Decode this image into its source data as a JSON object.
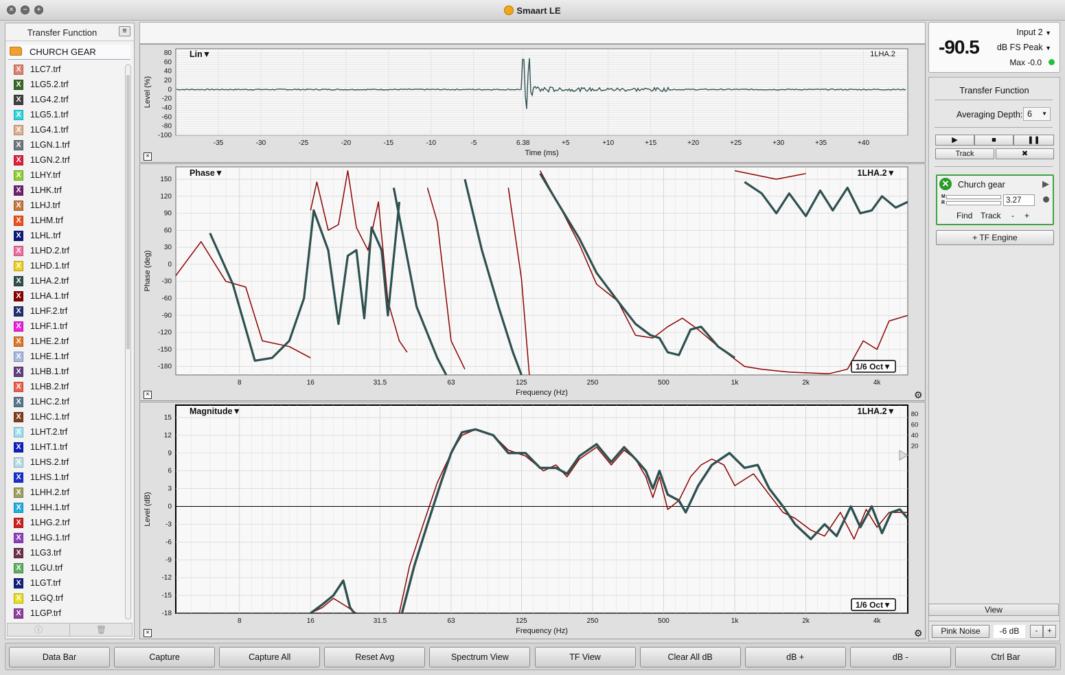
{
  "window": {
    "title": "Smaart LE"
  },
  "left_panel": {
    "title": "Transfer Function",
    "folder": "CHURCH GEAR",
    "files": [
      {
        "name": "1LC7.trf",
        "color": "#e08070"
      },
      {
        "name": "1LG5.2.trf",
        "color": "#3a6a2a"
      },
      {
        "name": "1LG4.2.trf",
        "color": "#404040"
      },
      {
        "name": "1LG5.1.trf",
        "color": "#30d8e0"
      },
      {
        "name": "1LG4.1.trf",
        "color": "#e0b090"
      },
      {
        "name": "1LGN.1.trf",
        "color": "#707880"
      },
      {
        "name": "1LGN.2.trf",
        "color": "#e02040"
      },
      {
        "name": "1LHY.trf",
        "color": "#90d030"
      },
      {
        "name": "1LHK.trf",
        "color": "#702070"
      },
      {
        "name": "1LHJ.trf",
        "color": "#c87840"
      },
      {
        "name": "1LHM.trf",
        "color": "#f05020"
      },
      {
        "name": "1LHL.trf",
        "color": "#101880"
      },
      {
        "name": "1LHD.2.trf",
        "color": "#f070a0"
      },
      {
        "name": "1LHD.1.trf",
        "color": "#f0d020"
      },
      {
        "name": "1LHA.2.trf",
        "color": "#2f5050"
      },
      {
        "name": "1LHA.1.trf",
        "color": "#8b0000"
      },
      {
        "name": "1LHF.2.trf",
        "color": "#203070"
      },
      {
        "name": "1LHF.1.trf",
        "color": "#f020e0"
      },
      {
        "name": "1LHE.2.trf",
        "color": "#e07828"
      },
      {
        "name": "1LHE.1.trf",
        "color": "#a8b8e0"
      },
      {
        "name": "1LHB.1.trf",
        "color": "#604080"
      },
      {
        "name": "1LHB.2.trf",
        "color": "#f06050"
      },
      {
        "name": "1LHC.2.trf",
        "color": "#5a7890"
      },
      {
        "name": "1LHC.1.trf",
        "color": "#804020"
      },
      {
        "name": "1LHT.2.trf",
        "color": "#a0e0f0"
      },
      {
        "name": "1LHT.1.trf",
        "color": "#1020c0"
      },
      {
        "name": "1LHS.2.trf",
        "color": "#b8e0e8"
      },
      {
        "name": "1LHS.1.trf",
        "color": "#1830d0"
      },
      {
        "name": "1LHH.2.trf",
        "color": "#a0a060"
      },
      {
        "name": "1LHH.1.trf",
        "color": "#20b0e0"
      },
      {
        "name": "1LHG.2.trf",
        "color": "#d02020"
      },
      {
        "name": "1LHG.1.trf",
        "color": "#9040c0"
      },
      {
        "name": "1LG3.trf",
        "color": "#703050"
      },
      {
        "name": "1LGU.trf",
        "color": "#60b060"
      },
      {
        "name": "1LGT.trf",
        "color": "#102080"
      },
      {
        "name": "1LGQ.trf",
        "color": "#e8e020"
      },
      {
        "name": "1LGP.trf",
        "color": "#9040a0"
      }
    ]
  },
  "lin_graph": {
    "title": "Lin▼",
    "trace": "1LHA.2",
    "ylabel": "Level (%)",
    "xlabel": "Time (ms)",
    "yticks": [
      "80",
      "60",
      "40",
      "20",
      "0",
      "-20",
      "-40",
      "-60",
      "-80",
      "-100"
    ],
    "xticks": [
      "-35",
      "-30",
      "-25",
      "-20",
      "-15",
      "-10",
      "-5",
      "6.38",
      "+5",
      "+10",
      "+15",
      "+20",
      "+25",
      "+30",
      "+35",
      "+40"
    ]
  },
  "phase_graph": {
    "title": "Phase▼",
    "trace": "1LHA.2▼",
    "ylabel": "Phase (deg)",
    "xlabel": "Frequency (Hz)",
    "smoothing": "1/6 Oct▼",
    "yticks": [
      "150",
      "120",
      "90",
      "60",
      "30",
      "0",
      "-30",
      "-60",
      "-90",
      "-120",
      "-150",
      "-180"
    ],
    "xticks": [
      "8",
      "16",
      "31.5",
      "63",
      "125",
      "250",
      "500",
      "1k",
      "2k",
      "4k"
    ]
  },
  "mag_graph": {
    "title": "Magnitude▼",
    "trace": "1LHA.2▼",
    "ylabel": "Level (dB)",
    "xlabel": "Frequency (Hz)",
    "smoothing": "1/6 Oct▼",
    "yticks": [
      "15",
      "12",
      "9",
      "6",
      "3",
      "0",
      "-3",
      "-6",
      "-9",
      "-12",
      "-15",
      "-18"
    ],
    "xticks": [
      "8",
      "16",
      "31.5",
      "63",
      "125",
      "250",
      "500",
      "1k",
      "2k",
      "4k"
    ],
    "coherence_ticks": [
      "80",
      "60",
      "40",
      "20"
    ]
  },
  "meter": {
    "value": "-90.5",
    "input": "Input 2",
    "mode": "dB FS Peak",
    "max": "Max -0.0",
    "status_color": "#22c040"
  },
  "tf_panel": {
    "title": "Transfer Function",
    "averaging_label": "Averaging Depth:",
    "averaging_value": "6",
    "track_label": "Track",
    "engine_name": "Church gear",
    "delay_value": "3.27",
    "find_label": "Find",
    "engine_track_label": "Track",
    "minus_label": "-",
    "plus_label": "+",
    "add_engine_label": "+ TF Engine",
    "meter_m": "M",
    "meter_r": "R"
  },
  "view_label": "View",
  "generator": {
    "label": "Pink Noise",
    "level": "-6 dB",
    "minus": "-",
    "plus": "+"
  },
  "bottom_bar": [
    "Data Bar",
    "Capture",
    "Capture All",
    "Reset Avg",
    "Spectrum View",
    "TF View",
    "Clear All dB",
    "dB +",
    "dB -",
    "Ctrl Bar"
  ],
  "colors": {
    "measured_trace": "#2f5050",
    "reference_trace": "#8b0000",
    "engine_accent": "#3fa33f"
  }
}
